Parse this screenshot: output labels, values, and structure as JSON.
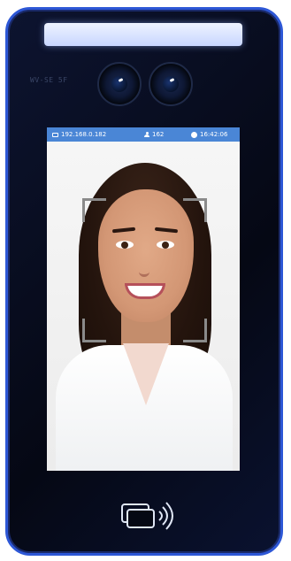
{
  "device": {
    "model_text": "WV-SE 5F"
  },
  "status_bar": {
    "ip": "192.168.0.182",
    "count": "162",
    "time": "16:42:06"
  },
  "icons": {
    "ip": "monitor-icon",
    "count": "person-icon",
    "time": "clock-icon",
    "reader": "nfc-card-icon"
  },
  "colors": {
    "bezel": "#050814",
    "border_accent": "#2d57d6",
    "status_bar": "#4a86d6",
    "light_bar": "#dfe8ff",
    "face_frame": "#8a8a8a"
  }
}
